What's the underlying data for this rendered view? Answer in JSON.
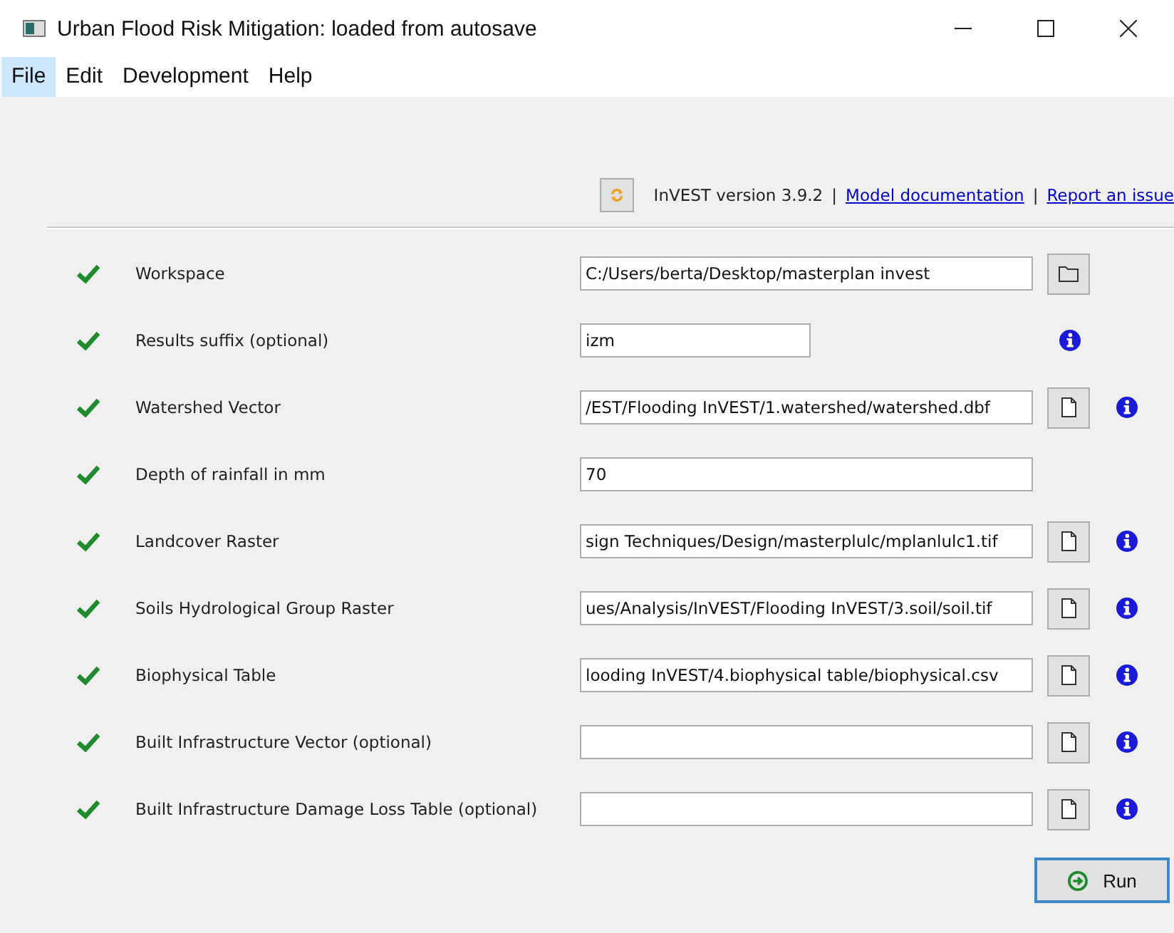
{
  "window": {
    "title": "Urban Flood Risk Mitigation: loaded from autosave"
  },
  "menu": [
    {
      "label": "File",
      "selected": true
    },
    {
      "label": "Edit",
      "selected": false
    },
    {
      "label": "Development",
      "selected": false
    },
    {
      "label": "Help",
      "selected": false
    }
  ],
  "header": {
    "version": "InVEST version 3.9.2",
    "separator_1": "|",
    "link_1": "Model documentation",
    "separator_2": "|",
    "link_2": "Report an issue"
  },
  "inputs": [
    {
      "label": "Workspace",
      "valid": true,
      "value": "C:/Users/berta/Desktop/masterplan invest",
      "kind": "folder",
      "info": false
    },
    {
      "label": "Results suffix (optional)",
      "valid": true,
      "value": "izm",
      "kind": "short",
      "info": true
    },
    {
      "label": "Watershed Vector",
      "valid": true,
      "value": "/EST/Flooding InVEST/1.watershed/watershed.dbf",
      "kind": "file",
      "info": true
    },
    {
      "label": "Depth of rainfall in mm",
      "valid": true,
      "value": "70",
      "kind": "plain",
      "info": false
    },
    {
      "label": "Landcover Raster",
      "valid": true,
      "value": "sign Techniques/Design/masterplulc/mplanlulc1.tif",
      "kind": "file",
      "info": true
    },
    {
      "label": "Soils Hydrological Group Raster",
      "valid": true,
      "value": "ues/Analysis/InVEST/Flooding InVEST/3.soil/soil.tif",
      "kind": "file",
      "info": true
    },
    {
      "label": "Biophysical Table",
      "valid": true,
      "value": "looding InVEST/4.biophysical table/biophysical.csv",
      "kind": "file",
      "info": true
    },
    {
      "label": "Built Infrastructure Vector (optional)",
      "valid": true,
      "kind": "file",
      "info": true
    },
    {
      "label": "Built Infrastructure Damage Loss Table (optional)",
      "valid": true,
      "kind": "file",
      "info": true
    }
  ],
  "run_button": {
    "label": "Run"
  }
}
